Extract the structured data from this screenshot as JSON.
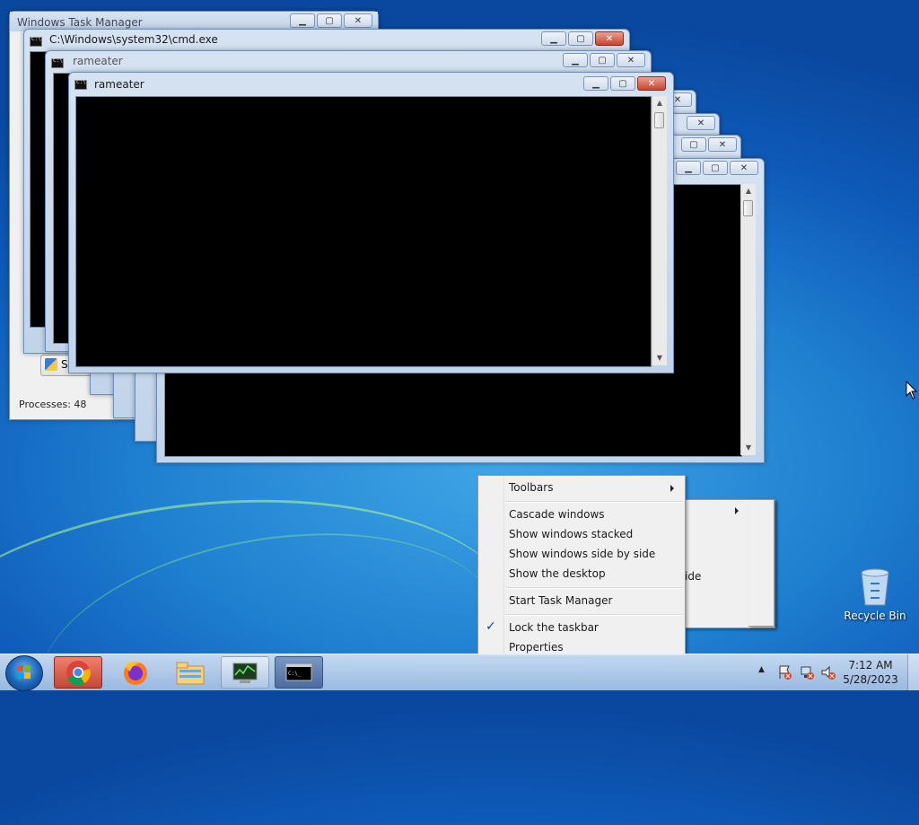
{
  "desktop": {
    "recycle_bin_label": "Recycle Bin"
  },
  "task_manager": {
    "title": "Windows Task Manager",
    "processes_label": "Processes: 48",
    "show_button_fragment": "Sl"
  },
  "windows": {
    "cmd_title": "C:\\Windows\\system32\\cmd.exe",
    "rameater_back_title": "rameater",
    "rameater_front_title": "rameater"
  },
  "context_menu": {
    "items": [
      {
        "label": "Toolbars",
        "submenu": true
      },
      {
        "label": "Cascade windows"
      },
      {
        "label": "Show windows stacked"
      },
      {
        "label": "Show windows side by side"
      },
      {
        "label": "Show the desktop"
      },
      {
        "label": "Start Task Manager"
      },
      {
        "label": "Lock the taskbar",
        "checked": true
      },
      {
        "label": "Properties"
      }
    ],
    "behind_fragment": "ide"
  },
  "taskbar": {
    "apps": [
      {
        "name": "chrome-icon"
      },
      {
        "name": "firefox-icon"
      },
      {
        "name": "explorer-icon"
      },
      {
        "name": "task-manager-icon"
      },
      {
        "name": "cmd-icon"
      }
    ],
    "clock_time": "7:12 AM",
    "clock_date": "5/28/2023"
  },
  "colors": {
    "desktop_blue": "#1f7fd0",
    "close_red": "#c8442f"
  }
}
